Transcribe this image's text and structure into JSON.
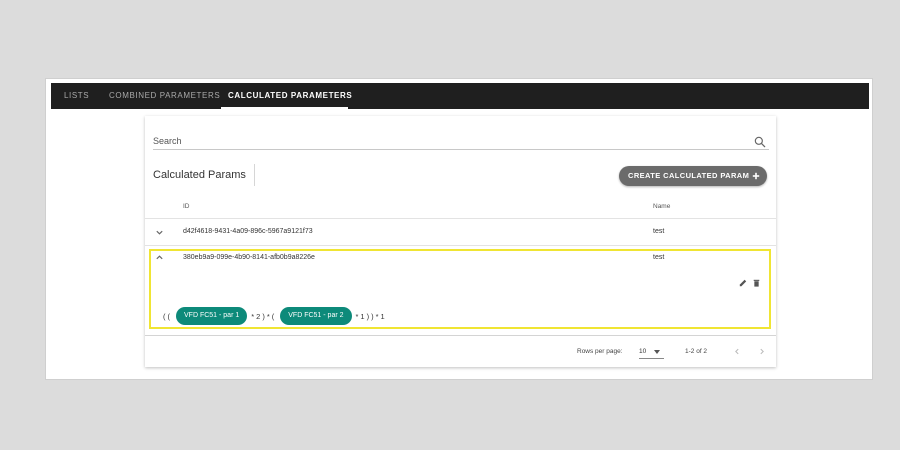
{
  "tabs": [
    {
      "label": "LISTS",
      "active": false
    },
    {
      "label": "COMBINED PARAMETERS",
      "active": false
    },
    {
      "label": "CALCULATED PARAMETERS",
      "active": true
    }
  ],
  "search": {
    "label": "Search",
    "icon": "search-icon"
  },
  "section": {
    "title": "Calculated Params"
  },
  "create_button": {
    "label": "CREATE CALCULATED PARAM",
    "icon": "plus-icon"
  },
  "table": {
    "headers": {
      "id": "ID",
      "name": "Name"
    },
    "rows": [
      {
        "id": "d42f4618-9431-4a09-896c-5967a9121f73",
        "name": "test",
        "expanded": false,
        "toggle_icon": "chevron-down-icon"
      },
      {
        "id": "380eb9a9-099e-4b90-8141-afb0b9a8226e",
        "name": "test",
        "expanded": true,
        "toggle_icon": "chevron-up-icon"
      }
    ]
  },
  "expanded": {
    "actions": {
      "edit_icon": "pencil-icon",
      "delete_icon": "trash-icon"
    },
    "formula": {
      "prefix": "((",
      "chip1": "VFD FC51 - par 1",
      "middle": "*2)*(",
      "chip2": "VFD FC51 - par 2",
      "suffix": "*1))*1"
    }
  },
  "pagination": {
    "rows_per_page_label": "Rows per page:",
    "rows_per_page_value": "10",
    "range": "1-2 of 2",
    "prev_icon": "chevron-left-icon",
    "next_icon": "chevron-right-icon"
  },
  "colors": {
    "tabbar": "#1f1f1f",
    "chip": "#0d8a7a",
    "button": "#6b6b6b",
    "highlight": "#f0e533"
  }
}
